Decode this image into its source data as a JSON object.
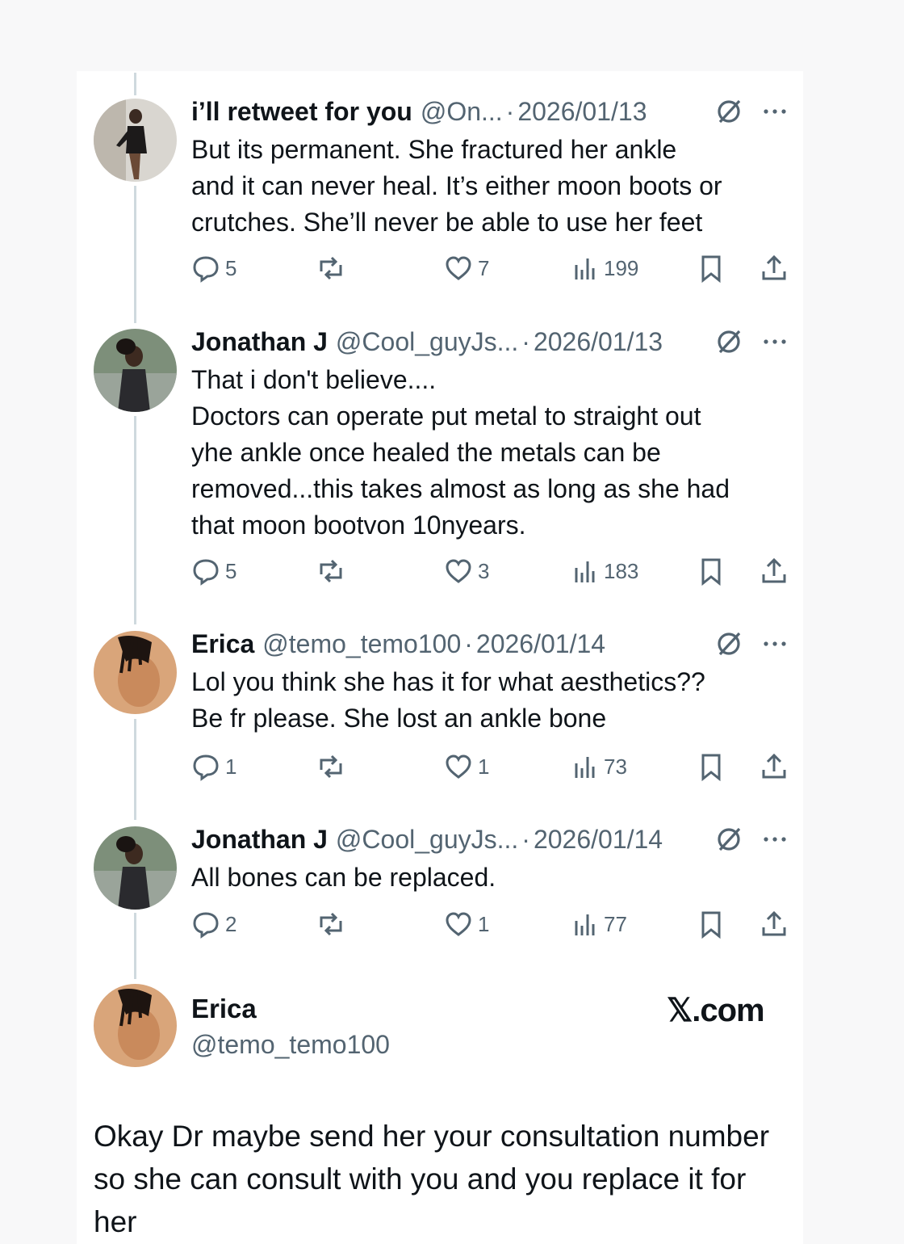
{
  "tweets": [
    {
      "name": "i’ll retweet for you",
      "handle": "@On...",
      "sep": "·",
      "date": "2026/01/13",
      "text": "But its permanent. She fractured her ankle\nand it can never heal. It’s either moon boots or\ncrutches. She’ll never be able to use her feet",
      "replies": "5",
      "likes": "7",
      "views": "199"
    },
    {
      "name": "Jonathan J",
      "handle": "@Cool_guyJs...",
      "sep": "·",
      "date": "2026/01/13",
      "text": "That i don't believe....\nDoctors can operate put metal to straight out\nyhe ankle once healed the metals can be\nremoved...this takes almost as long as she had\nthat moon bootvon 10nyears.",
      "replies": "5",
      "likes": "3",
      "views": "183"
    },
    {
      "name": "Erica",
      "handle": "@temo_temo100",
      "sep": "·",
      "date": "2026/01/14",
      "text": "Lol you think she has it for what aesthetics??\nBe fr please. She lost an ankle bone",
      "replies": "1",
      "likes": "1",
      "views": "73"
    },
    {
      "name": "Jonathan J",
      "handle": "@Cool_guyJs...",
      "sep": "·",
      "date": "2026/01/14",
      "text": "All bones can be replaced.",
      "replies": "2",
      "likes": "1",
      "views": "77"
    }
  ],
  "final_post": {
    "name": "Erica",
    "handle": "@temo_temo100",
    "brand": "𝕏.com",
    "text": "Okay Dr maybe send her your consultation number so she can consult with you and you replace it for her"
  },
  "colors": {
    "text": "#0f1419",
    "secondary": "#536471",
    "thread_line": "#cfd9de"
  }
}
